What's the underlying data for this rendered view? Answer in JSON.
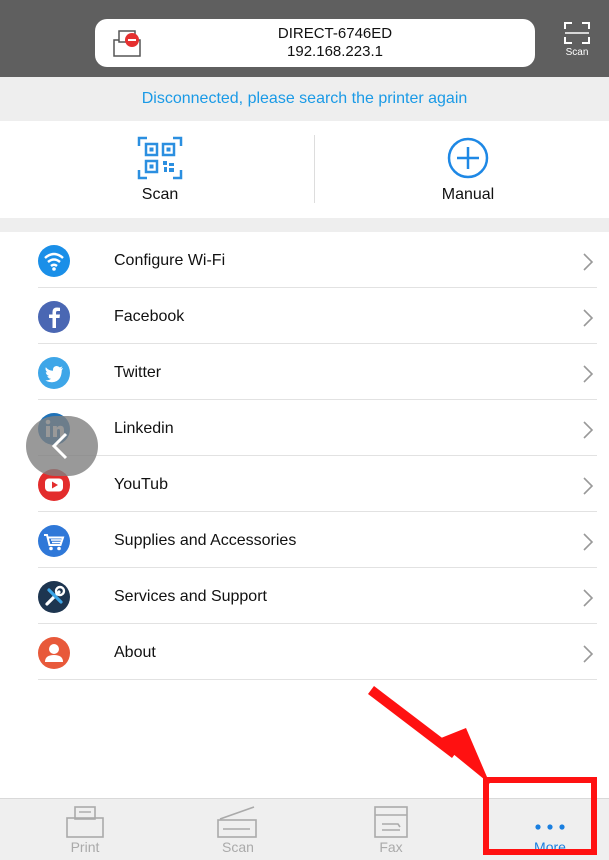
{
  "header": {
    "printer_name": "DIRECT-6746ED",
    "printer_ip": "192.168.223.1",
    "scan_label": "Scan",
    "icons": [
      "printer-disconnected-icon",
      "scan-frame-icon"
    ]
  },
  "status": {
    "text": "Disconnected, please search the printer again",
    "color": "#1a9ae6"
  },
  "actions": {
    "scan_label": "Scan",
    "manual_label": "Manual",
    "icons": [
      "qr-code-icon",
      "plus-circle-icon"
    ]
  },
  "menu": {
    "items": [
      {
        "label": "Configure Wi-Fi",
        "icon": "wifi-icon",
        "color": "#1a8fe8"
      },
      {
        "label": "Facebook",
        "icon": "facebook-icon",
        "color": "#4a67b3"
      },
      {
        "label": "Twitter",
        "icon": "twitter-icon",
        "color": "#3ea6e8"
      },
      {
        "label": "Linkedin",
        "icon": "linkedin-icon",
        "color": "#1f72b8"
      },
      {
        "label": "YouTub",
        "icon": "youtube-icon",
        "color": "#e32c2c"
      },
      {
        "label": "Supplies and Accessories",
        "icon": "cart-icon",
        "color": "#2f78d8"
      },
      {
        "label": "Services and Support",
        "icon": "tools-icon",
        "color": "#1d3550"
      },
      {
        "label": "About",
        "icon": "person-icon",
        "color": "#e8593a"
      }
    ]
  },
  "tabbar": {
    "print_label": "Print",
    "scan_label": "Scan",
    "fax_label": "Fax",
    "more_label": "More",
    "active": "More",
    "active_color": "#1a7fe0",
    "inactive_color": "#aaaaaa"
  },
  "overlay": {
    "highlight_color": "#ff1111"
  }
}
